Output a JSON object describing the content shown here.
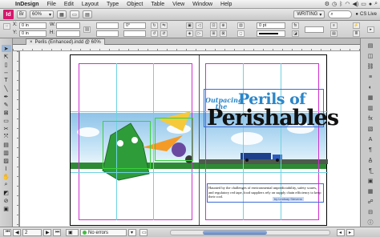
{
  "menubar": {
    "apple": "",
    "items": [
      "InDesign",
      "File",
      "Edit",
      "Layout",
      "Type",
      "Object",
      "Table",
      "View",
      "Window",
      "Help"
    ]
  },
  "appbar": {
    "logo": "Id",
    "zoom": "60%",
    "workspace": "WRITING",
    "search_placeholder": "",
    "cs_live": "CS Live"
  },
  "control": {
    "x_label": "X:",
    "x_value": "0 in",
    "y_label": "Y:",
    "y_value": "0 in",
    "w_label": "W:",
    "h_label": "H:",
    "stroke_weight": "0 pt",
    "angle": "0°"
  },
  "document": {
    "tab_title": "Perils (Enhanced).indd @ 60%"
  },
  "artwork": {
    "headline_small": "Outpacing the",
    "headline_medium": "Perils of",
    "headline_large": "Perishables",
    "body": "Haunted by the challenges of environmental unpredictability, safety scares, and regulatory red tape, food suppliers rely on supply chain efficiency to keep their cool.",
    "byline": "by Lindsay Stevens"
  },
  "status": {
    "page": "2",
    "preflight": "No errors"
  },
  "colors": {
    "accent": "#2a86c9",
    "margin_guide": "#d030d0",
    "column_guide": "#6fd3e0",
    "preflight_ok": "#3fbf3f"
  }
}
